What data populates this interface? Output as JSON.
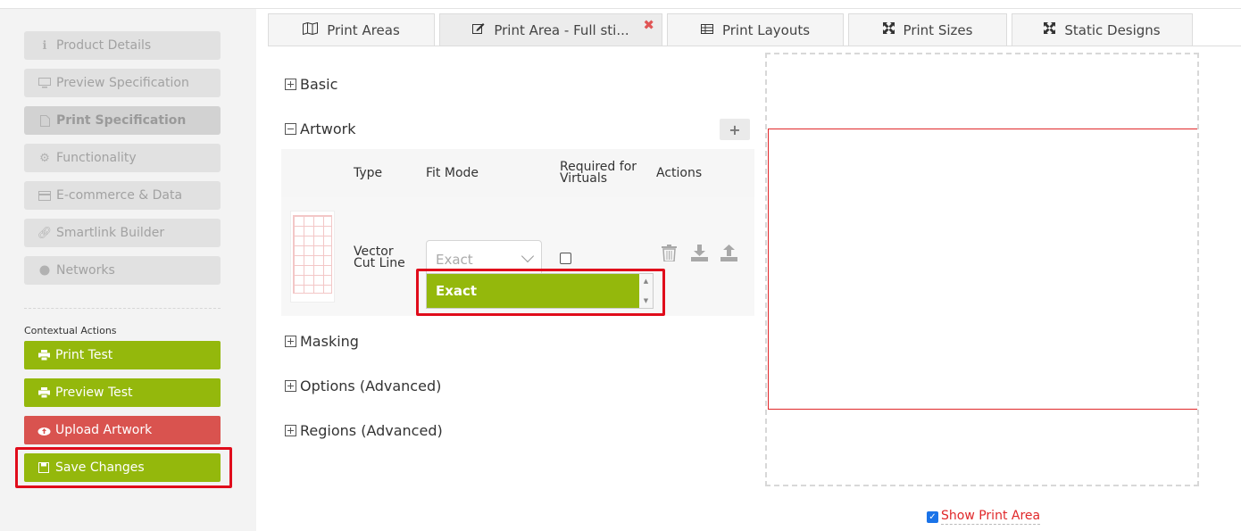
{
  "sidebar": {
    "nav": [
      {
        "label": "Product Details",
        "icon": "info-icon"
      },
      {
        "label": "Preview Specification",
        "icon": "monitor-icon"
      },
      {
        "label": "Print Specification",
        "icon": "pdf-icon"
      },
      {
        "label": "Functionality",
        "icon": "gears-icon"
      },
      {
        "label": "E-commerce & Data",
        "icon": "credit-card-icon"
      },
      {
        "label": "Smartlink Builder",
        "icon": "link-icon"
      },
      {
        "label": "Networks",
        "icon": "globe-icon"
      }
    ],
    "contextual_label": "Contextual Actions",
    "actions": [
      {
        "label": "Print Test",
        "icon": "printer-icon"
      },
      {
        "label": "Preview Test",
        "icon": "printer-icon"
      },
      {
        "label": "Upload Artwork",
        "icon": "cloud-upload-icon"
      },
      {
        "label": "Save Changes",
        "icon": "save-icon"
      }
    ]
  },
  "tabs": [
    {
      "label": "Print Areas",
      "icon": "map-icon"
    },
    {
      "label": "Print Area - Full sti...",
      "icon": "edit-icon",
      "close": "✖"
    },
    {
      "label": "Print Layouts",
      "icon": "table-icon"
    },
    {
      "label": "Print Sizes",
      "icon": "expand-icon"
    },
    {
      "label": "Static Designs",
      "icon": "expand-icon"
    }
  ],
  "sections": {
    "basic": "Basic",
    "artwork": "Artwork",
    "masking": "Masking",
    "options": "Options (Advanced)",
    "regions": "Regions (Advanced)"
  },
  "artwork_table": {
    "headers": {
      "type": "Type",
      "fit_mode": "Fit Mode",
      "required_line1": "Required for",
      "required_line2": "Virtuals",
      "actions": "Actions"
    },
    "row": {
      "type_line1": "Vector",
      "type_line2": "Cut Line",
      "fit_mode_value": "Exact",
      "required": false
    },
    "add_label": "+"
  },
  "fit_dropdown": {
    "options": [
      "Exact"
    ],
    "selected": "Exact",
    "scroll_up": "▲",
    "scroll_down": "▼"
  },
  "preview": {
    "show_print_area_label": "Show Print Area",
    "show_print_area_checked": true
  },
  "colors": {
    "accent_green": "#94b80c",
    "danger_red": "#d9534f",
    "highlight": "#e00c1b"
  }
}
